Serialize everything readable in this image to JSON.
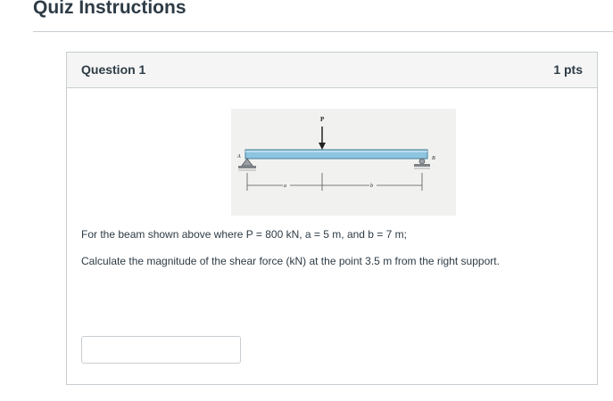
{
  "page": {
    "title": "Quiz Instructions"
  },
  "question": {
    "title": "Question 1",
    "points": "1 pts",
    "figure_labels": {
      "load": "P",
      "left_support": "A",
      "right_support": "B",
      "dim_a": "a",
      "dim_b": "b"
    },
    "text_line_1": "For the beam shown above where P = 800 kN, a = 5 m, and b = 7 m;",
    "text_line_2": "Calculate the magnitude of the shear force (kN) at the point 3.5 m from the right support.",
    "answer_value": ""
  }
}
